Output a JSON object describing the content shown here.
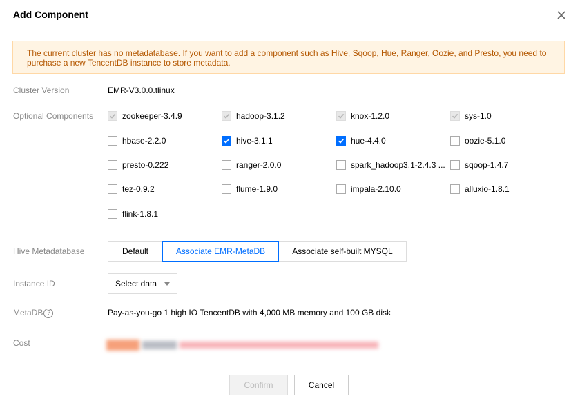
{
  "dialog": {
    "title": "Add Component",
    "notice": "The current cluster has no metadatabase. If you want to add a component such as Hive, Sqoop, Hue, Ranger, Oozie, and Presto, you need to purchase a new TencentDB instance to store metadata."
  },
  "cluster_version": {
    "label": "Cluster Version",
    "value": "EMR-V3.0.0.tlinux"
  },
  "optional_components": {
    "label": "Optional Components",
    "items": [
      {
        "name": "zookeeper-3.4.9",
        "state": "disabled"
      },
      {
        "name": "hadoop-3.1.2",
        "state": "disabled"
      },
      {
        "name": "knox-1.2.0",
        "state": "disabled"
      },
      {
        "name": "sys-1.0",
        "state": "disabled"
      },
      {
        "name": "hbase-2.2.0",
        "state": "unchecked"
      },
      {
        "name": "hive-3.1.1",
        "state": "checked"
      },
      {
        "name": "hue-4.4.0",
        "state": "checked"
      },
      {
        "name": "oozie-5.1.0",
        "state": "unchecked"
      },
      {
        "name": "presto-0.222",
        "state": "unchecked"
      },
      {
        "name": "ranger-2.0.0",
        "state": "unchecked"
      },
      {
        "name": "spark_hadoop3.1-2.4.3 ...",
        "state": "unchecked"
      },
      {
        "name": "sqoop-1.4.7",
        "state": "unchecked"
      },
      {
        "name": "tez-0.9.2",
        "state": "unchecked"
      },
      {
        "name": "flume-1.9.0",
        "state": "unchecked"
      },
      {
        "name": "impala-2.10.0",
        "state": "unchecked"
      },
      {
        "name": "alluxio-1.8.1",
        "state": "unchecked"
      },
      {
        "name": "flink-1.8.1",
        "state": "unchecked"
      }
    ]
  },
  "hive_metadatabase": {
    "label": "Hive Metadatabase",
    "options": [
      "Default",
      "Associate EMR-MetaDB",
      "Associate self-built MYSQL"
    ],
    "selected": "Associate EMR-MetaDB"
  },
  "instance_id": {
    "label": "Instance ID",
    "value": "Select data"
  },
  "metadb": {
    "label": "MetaDB",
    "help_icon": "?",
    "value": "Pay-as-you-go 1 high IO TencentDB with 4,000 MB memory and 100 GB disk"
  },
  "cost": {
    "label": "Cost"
  },
  "footer": {
    "confirm": "Confirm",
    "cancel": "Cancel"
  },
  "colors": {
    "accent": "#006eff",
    "notice_bg": "#fff4e3",
    "notice_text": "#b45700"
  }
}
